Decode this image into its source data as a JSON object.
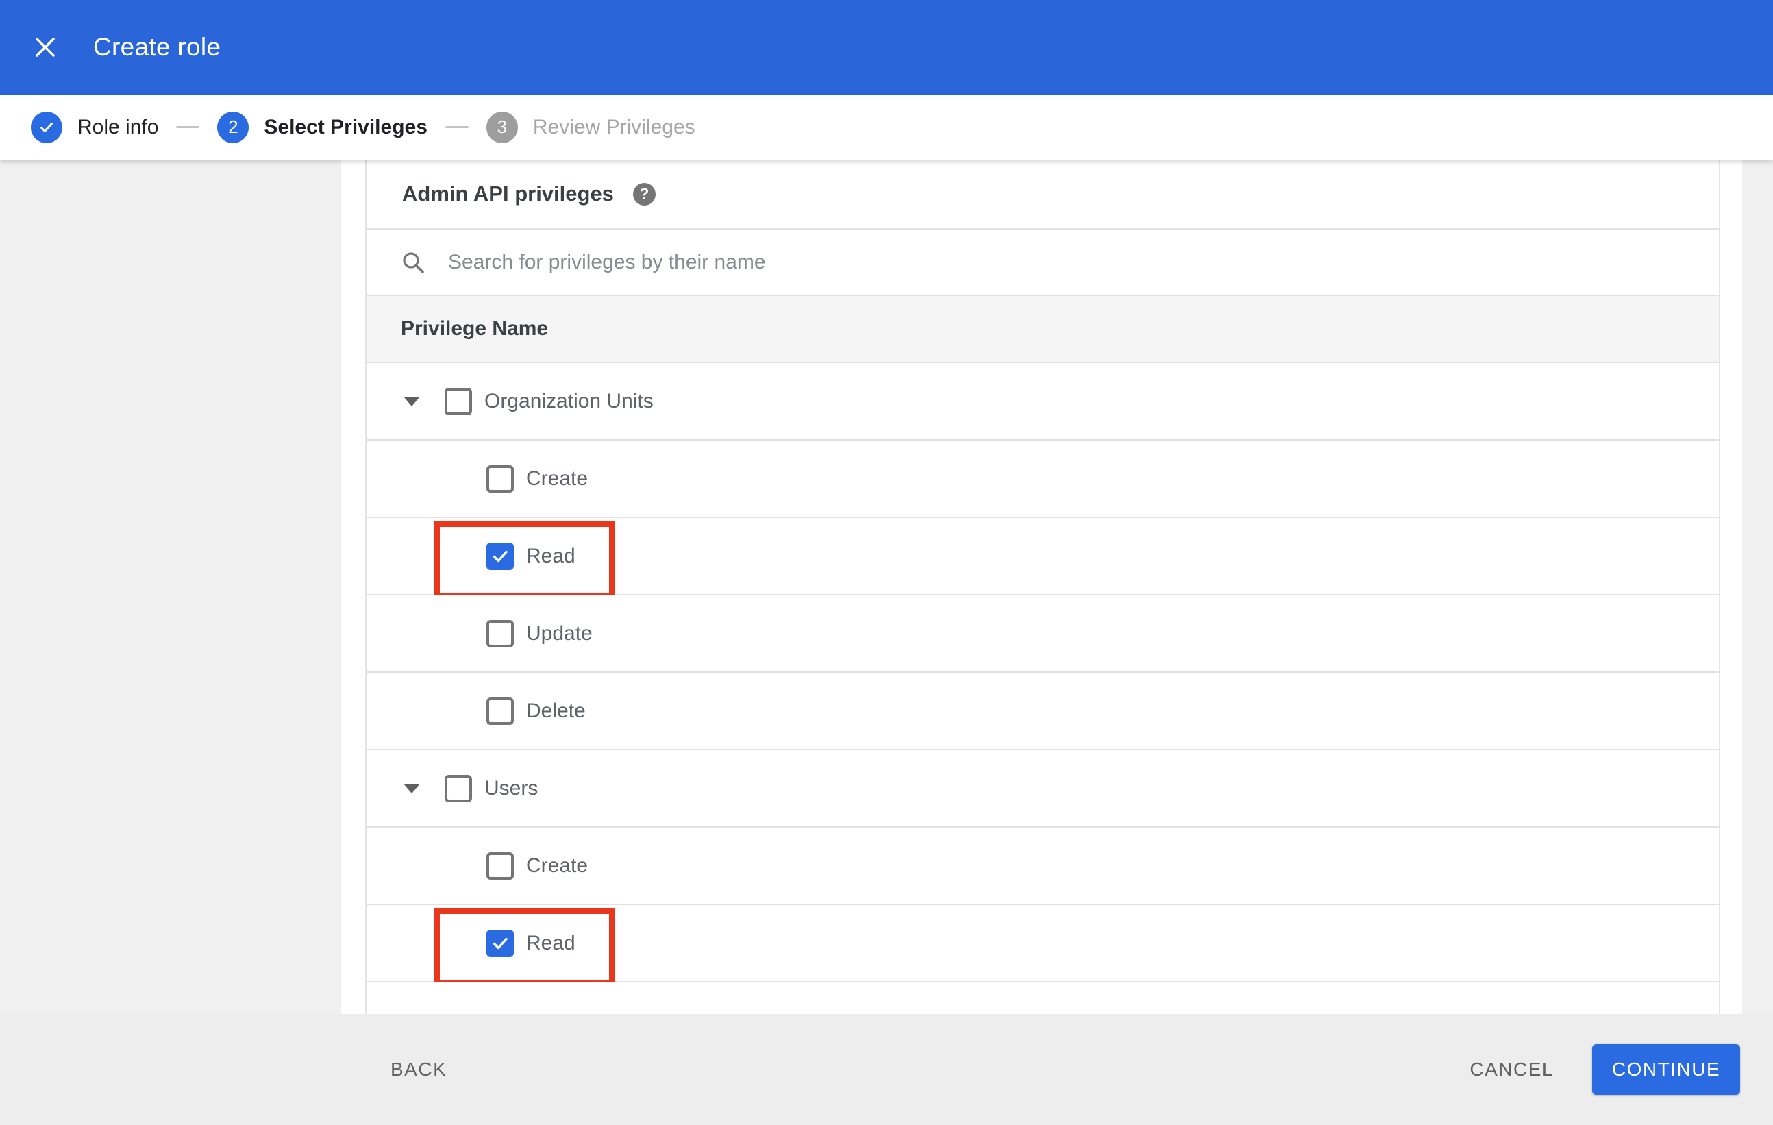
{
  "appbar": {
    "title": "Create role",
    "close_icon": "close-icon"
  },
  "stepper": {
    "steps": [
      {
        "number": "1",
        "label": "Role info",
        "state": "completed",
        "icon": "check-icon"
      },
      {
        "number": "2",
        "label": "Select Privileges",
        "state": "active"
      },
      {
        "number": "3",
        "label": "Review Privileges",
        "state": "upcoming"
      }
    ]
  },
  "content": {
    "heading": "Admin API privileges",
    "help_icon": "help-icon",
    "help_glyph": "?",
    "search": {
      "icon": "search-icon",
      "placeholder": "Search for privileges by their name",
      "value": ""
    },
    "table": {
      "header": "Privilege Name",
      "rows": [
        {
          "label": "Organization Units",
          "level": "parent",
          "expanded": true,
          "checked": false,
          "highlighted": false
        },
        {
          "label": "Create",
          "level": "child",
          "checked": false,
          "highlighted": false
        },
        {
          "label": "Read",
          "level": "child",
          "checked": true,
          "highlighted": true
        },
        {
          "label": "Update",
          "level": "child",
          "checked": false,
          "highlighted": false
        },
        {
          "label": "Delete",
          "level": "child",
          "checked": false,
          "highlighted": false
        },
        {
          "label": "Users",
          "level": "parent",
          "expanded": true,
          "checked": false,
          "highlighted": false
        },
        {
          "label": "Create",
          "level": "child",
          "checked": false,
          "highlighted": false
        },
        {
          "label": "Read",
          "level": "child",
          "checked": true,
          "highlighted": true
        }
      ]
    }
  },
  "footer": {
    "back_label": "BACK",
    "cancel_label": "CANCEL",
    "continue_label": "CONTINUE"
  },
  "colors": {
    "blue-appbar": "#2a65d9",
    "blue-accent": "#2b6be2",
    "red-annotation": "#e8371c",
    "page-bg": "#f0f0f0",
    "footer-bg": "#ededed",
    "header-row-bg": "#f5f5f5",
    "divider": "#e2e2e2"
  }
}
